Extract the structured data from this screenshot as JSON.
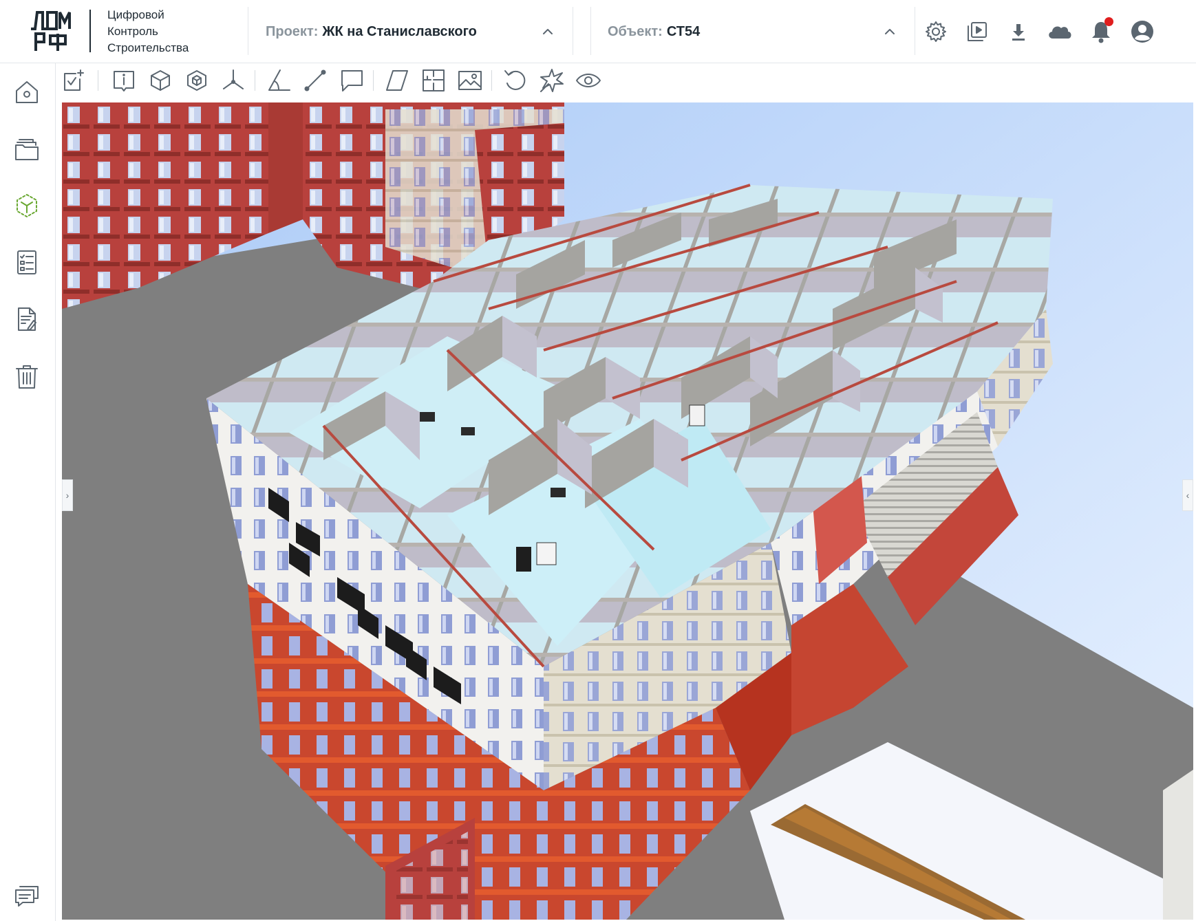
{
  "brand": {
    "logo_text": "ДОМ РФ",
    "line1": "Цифровой",
    "line2": "Контроль",
    "line3": "Строительства"
  },
  "project": {
    "label": "Проект:",
    "value": "ЖК на Станиславского"
  },
  "object": {
    "label": "Объект:",
    "value": "СТ54"
  },
  "header_icons": [
    "settings-icon",
    "play-video-icon",
    "download-icon",
    "cloud-icon",
    "bell-icon",
    "user-icon"
  ],
  "notification_badge_color": "#e01e1e",
  "accent_color": "#6aa832",
  "sidebar_items": [
    "home-icon",
    "folders-icon",
    "model-3d-icon",
    "checklist-icon",
    "document-edit-icon",
    "trash-icon",
    "chat-icon"
  ],
  "sidebar_active": "model-3d-icon",
  "toolbar_items": [
    "task-add-icon",
    "info-icon",
    "cube-icon",
    "cube-solid-icon",
    "axes-icon",
    "angle-measure-icon",
    "line-measure-icon",
    "comment-icon",
    "section-plane-icon",
    "floor-plan-icon",
    "image-icon",
    "reset-view-icon",
    "explode-icon",
    "visibility-icon"
  ],
  "viewport": {
    "content": "3D BIM model of residential building"
  }
}
